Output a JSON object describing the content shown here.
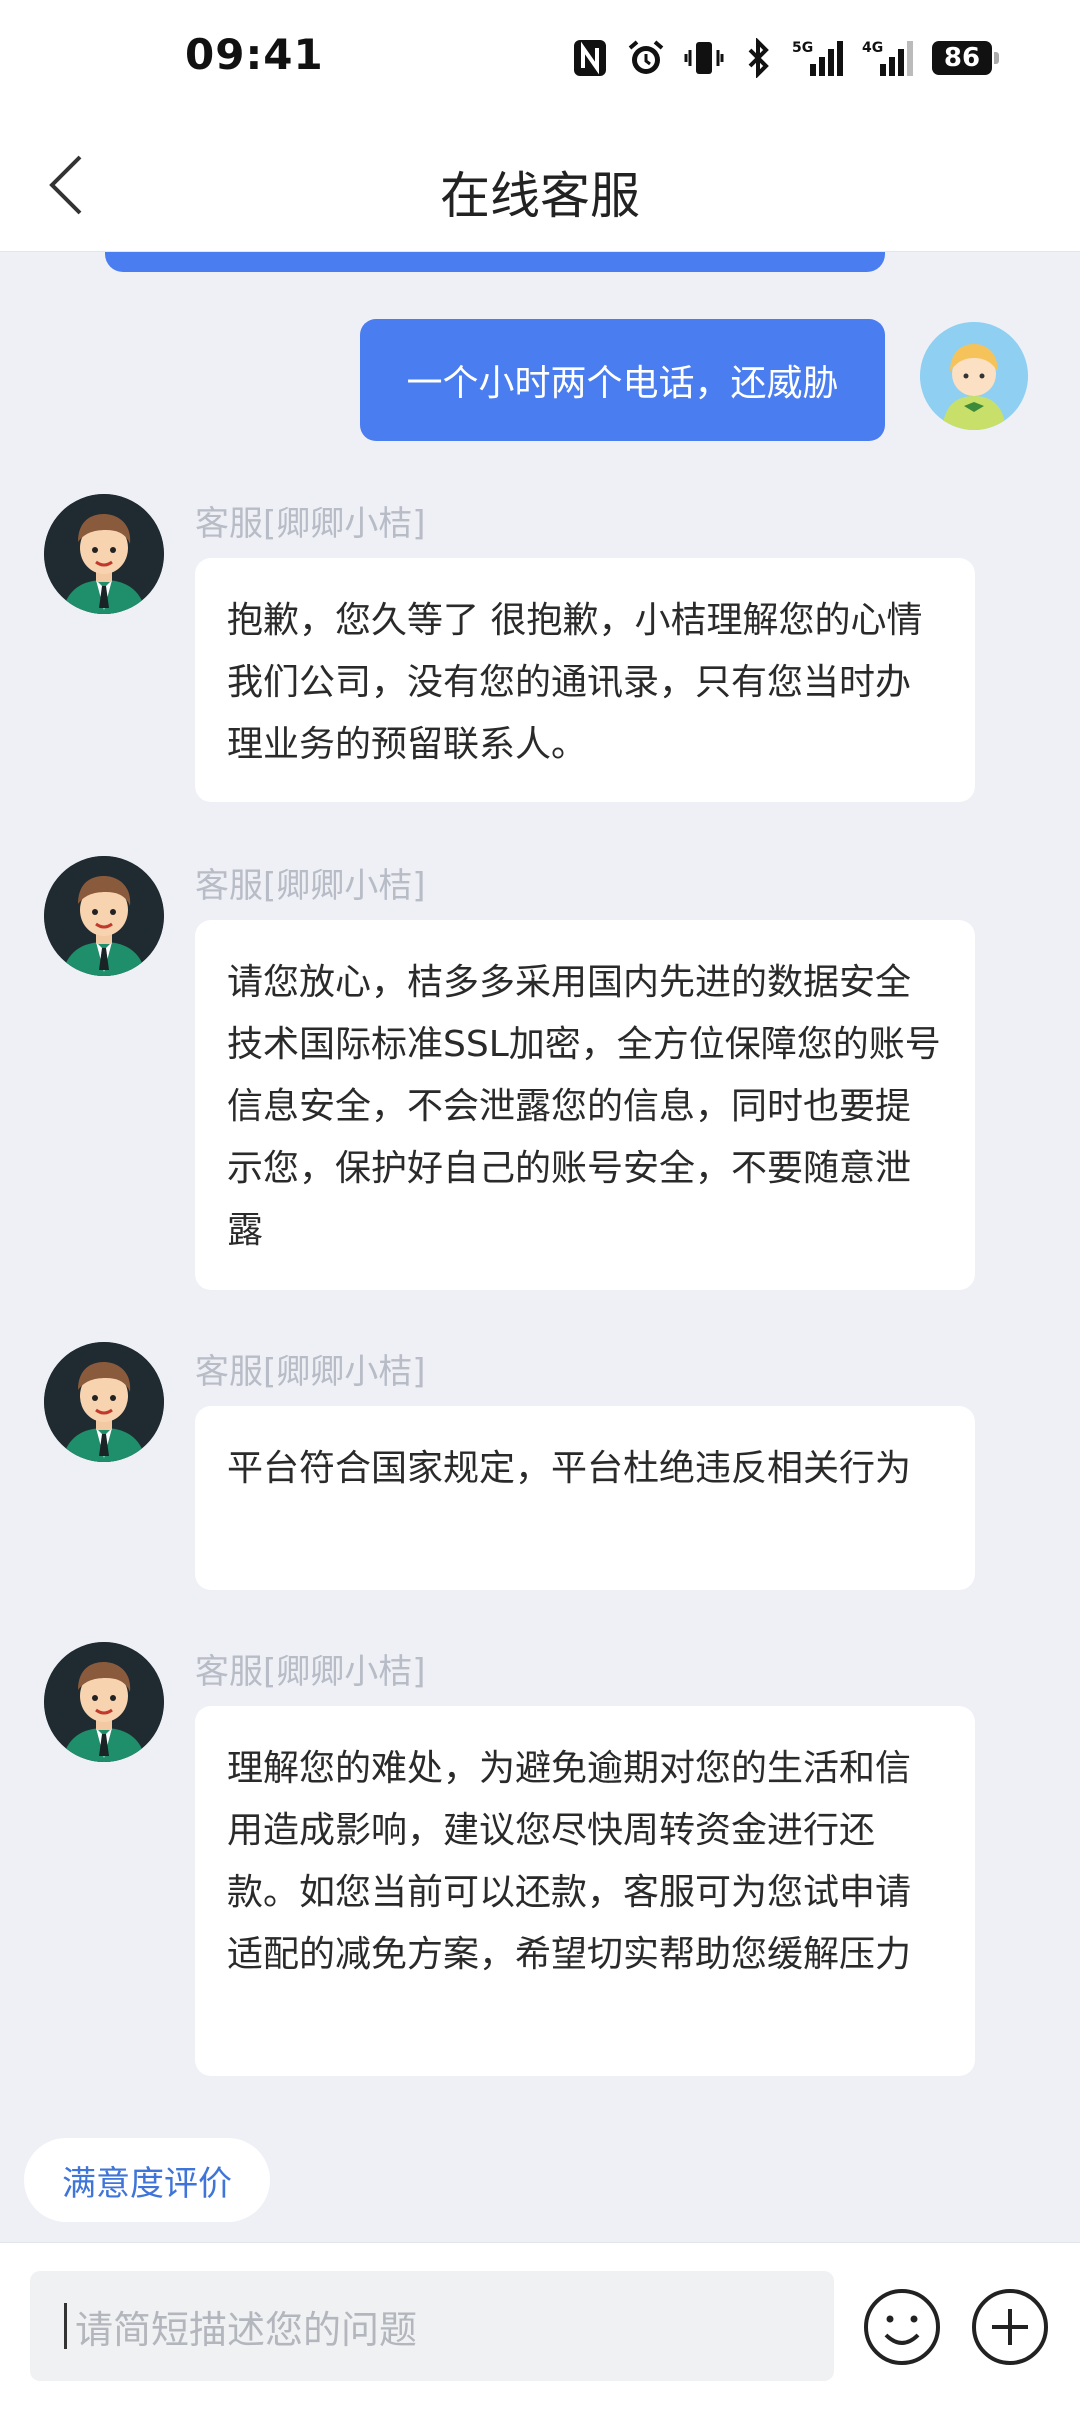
{
  "status_bar": {
    "time": "09:41",
    "icons": [
      "nfc-icon",
      "alarm-icon",
      "vibrate-icon",
      "bluetooth-icon",
      "signal-5g-icon",
      "signal-4g-icon"
    ],
    "signal_5g_label": "5G",
    "signal_4g_label": "4G",
    "battery": "86"
  },
  "header": {
    "title": "在线客服"
  },
  "colors": {
    "accent": "#4a7df0",
    "background": "#eef0f6",
    "link": "#3f74d8"
  },
  "messages": [
    {
      "from": "user",
      "text": "一个小时两个电话，还威胁"
    },
    {
      "from": "agent",
      "name": "客服[卿卿小桔]",
      "text": "抱歉，您久等了 很抱歉，小桔理解您的心情  我们公司，没有您的通讯录，只有您当时办理业务的预留联系人。"
    },
    {
      "from": "agent",
      "name": "客服[卿卿小桔]",
      "text": "请您放心，桔多多采用国内先进的数据安全技术国际标准SSL加密，全方位保障您的账号信息安全，不会泄露您的信息，同时也要提示您，保护好自己的账号安全，不要随意泄露"
    },
    {
      "from": "agent",
      "name": "客服[卿卿小桔]",
      "text": "平台符合国家规定，平台杜绝违反相关行为"
    },
    {
      "from": "agent",
      "name": "客服[卿卿小桔]",
      "text": "理解您的难处，为避免逾期对您的生活和信用造成影响，建议您尽快周转资金进行还款。如您当前可以还款，客服可为您试申请适配的减免方案，希望切实帮助您缓解压力"
    }
  ],
  "rating_button": "满意度评价",
  "input": {
    "placeholder": "请简短描述您的问题"
  }
}
